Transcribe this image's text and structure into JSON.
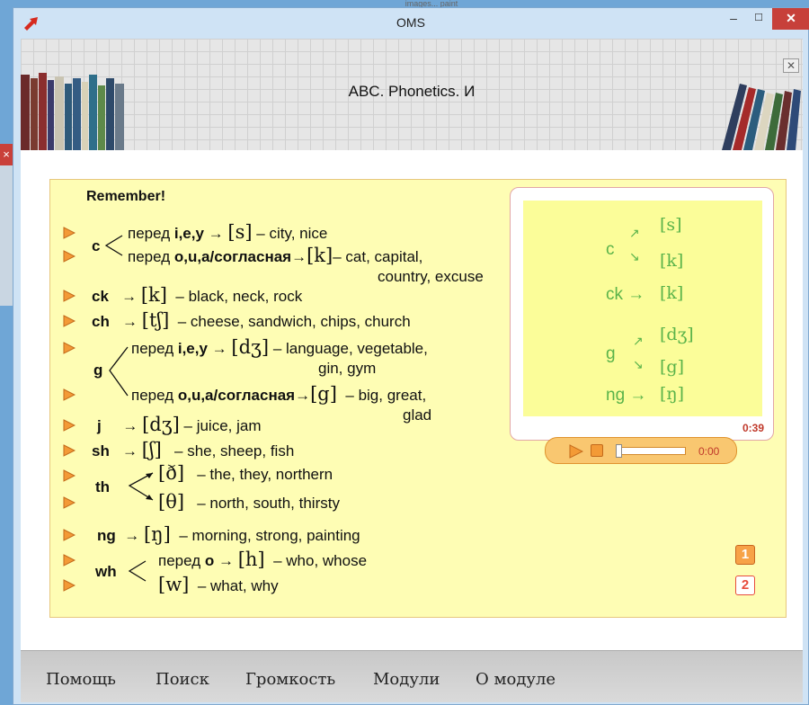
{
  "window": {
    "title": "OMS"
  },
  "lesson": {
    "title": "ABC. Phonetics. И"
  },
  "panel": {
    "heading": "Remember!",
    "rules": [
      {
        "id": "c1",
        "pre": "перед ",
        "ctx": "i,e,y",
        "arrow": "→",
        "phon": "[s]",
        "dash": " – ",
        "ex": "city, nice"
      },
      {
        "id": "c2",
        "pre": "перед ",
        "ctx": "o,u,a/согласная",
        "arrow": "→",
        "phon": "[k]",
        "dash": "– ",
        "ex": "cat, capital,",
        "ex2": "country, excuse"
      },
      {
        "id": "ck",
        "letter": "ck",
        "arrow": "→",
        "phon": "[k]",
        "dash": " – ",
        "ex": "black, neck, rock"
      },
      {
        "id": "ch",
        "letter": "ch",
        "arrow": "→",
        "phon": "[tʃ]",
        "dash": " – ",
        "ex": "cheese, sandwich, chips, church"
      },
      {
        "id": "g1",
        "pre": "перед ",
        "ctx": "i,e,y",
        "arrow": "→",
        "phon": "[dʒ]",
        "dash": " – ",
        "ex": "language, vegetable,",
        "ex2": "gin, gym"
      },
      {
        "id": "g2",
        "pre": "перед ",
        "ctx": "o,u,a/согласная",
        "arrow": "→",
        "phon": "[g]",
        "dash": " – ",
        "ex": "big, great,",
        "ex2": "glad"
      },
      {
        "id": "j",
        "letter": "j",
        "arrow": "→",
        "phon": "[dʒ]",
        "dash": " – ",
        "ex": "juice, jam"
      },
      {
        "id": "sh",
        "letter": "sh",
        "arrow": "→",
        "phon": "[ʃ]",
        "dash": " – ",
        "ex": "she, sheep, fish"
      },
      {
        "id": "th1",
        "phon": "[ð]",
        "dash": " – ",
        "ex": "the, they, northern"
      },
      {
        "id": "th2",
        "phon": "[θ]",
        "dash": " – ",
        "ex": "north, south, thirsty"
      },
      {
        "id": "ng",
        "letter": "ng",
        "arrow": "→",
        "phon": "[ŋ]",
        "dash": " – ",
        "ex": "morning, strong, painting"
      },
      {
        "id": "wh1",
        "pre": "перед ",
        "ctx": "o",
        "arrow": "→",
        "phon": "[h]",
        "dash": " – ",
        "ex": "who, whose"
      },
      {
        "id": "wh2",
        "phon": "[w]",
        "dash": " – ",
        "ex": "what, why"
      }
    ],
    "letters": {
      "c": "c",
      "g": "g",
      "th": "th",
      "wh": "wh"
    }
  },
  "player": {
    "screen": {
      "c": "c",
      "c_s": "[s]",
      "c_k": "[k]",
      "ck": "ck →",
      "ck_k": "[k]",
      "g": "g",
      "g_dz": "[dʒ]",
      "g_g": "[g]",
      "ng": "ng →",
      "ng_n": "[ŋ]"
    },
    "duration": "0:39",
    "current": "0:00",
    "progress": 0
  },
  "pages": [
    "1",
    "2"
  ],
  "menu": [
    "Помощь",
    "Поиск",
    "Громкость",
    "Модули",
    "О модуле"
  ],
  "colors": {
    "panel": "#fefdb4",
    "accent": "#f7a247",
    "screen_text": "#5ab34a"
  }
}
